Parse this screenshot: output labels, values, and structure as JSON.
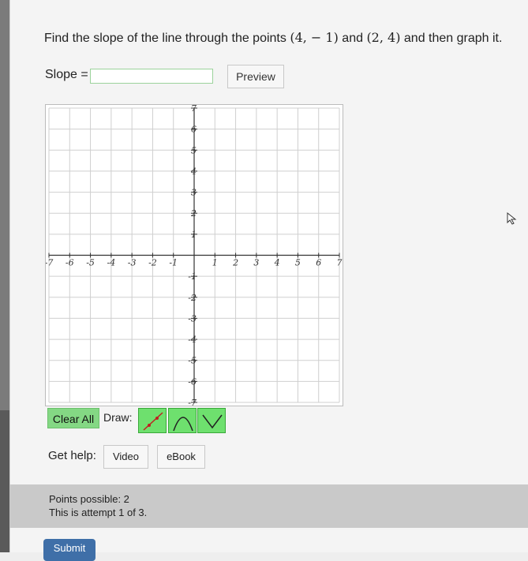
{
  "question": {
    "prefix": "Find the slope of the line through the points ",
    "point1": "(4, − 1)",
    "middle": " and ",
    "point2": "(2, 4)",
    "suffix": " and then graph it."
  },
  "slope": {
    "label": "Slope =",
    "value": "",
    "preview_label": "Preview"
  },
  "graph": {
    "x_range": [
      -7,
      7
    ],
    "y_range": [
      -7,
      7
    ],
    "grid_lines": 14,
    "x_tick_labels": [
      "-7",
      "-6",
      "-5",
      "-4",
      "-3",
      "-2",
      "-1",
      "1",
      "2",
      "3",
      "4",
      "5",
      "6",
      "7"
    ],
    "y_tick_labels": [
      "7",
      "6",
      "5",
      "4",
      "3",
      "2",
      "1",
      "-1",
      "-2",
      "-3",
      "-4",
      "-5",
      "-6",
      "-7"
    ]
  },
  "toolbar": {
    "clear_all": "Clear All",
    "draw_label": "Draw:",
    "tools": [
      "line-tool",
      "parabola-tool",
      "absolute-value-tool"
    ]
  },
  "help": {
    "label": "Get help:",
    "video": "Video",
    "ebook": "eBook"
  },
  "status": {
    "points_possible": "Points possible: 2",
    "attempt": "This is attempt 1 of 3."
  },
  "submit": {
    "label": "Submit"
  },
  "colors": {
    "tool_active": "#6ee06e",
    "clear_all_bg": "#84d884",
    "submit_bg": "#3f6fa8",
    "grid": "#cfcfcf"
  }
}
